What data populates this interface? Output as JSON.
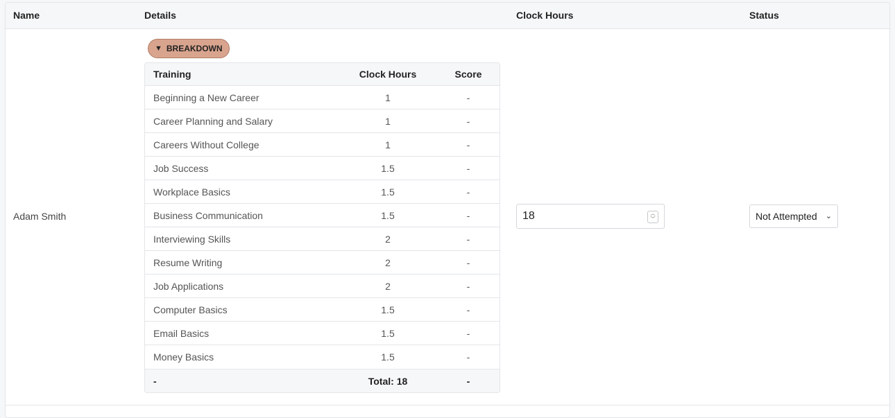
{
  "table": {
    "headers": {
      "name": "Name",
      "details": "Details",
      "clock_hours": "Clock Hours",
      "status": "Status"
    },
    "row": {
      "name": "Adam Smith",
      "breakdown_label": "BREAKDOWN",
      "breakdown_icon": "triangle-down-icon",
      "breakdown_color": "#d9a48e",
      "clock_hours_value": "18",
      "status_value": "Not Attempted"
    }
  },
  "breakdown": {
    "headers": {
      "training": "Training",
      "clock_hours": "Clock Hours",
      "score": "Score"
    },
    "rows": [
      {
        "training": "Beginning a New Career",
        "clock_hours": "1",
        "score": "-"
      },
      {
        "training": "Career Planning and Salary",
        "clock_hours": "1",
        "score": "-"
      },
      {
        "training": "Careers Without College",
        "clock_hours": "1",
        "score": "-"
      },
      {
        "training": "Job Success",
        "clock_hours": "1.5",
        "score": "-"
      },
      {
        "training": "Workplace Basics",
        "clock_hours": "1.5",
        "score": "-"
      },
      {
        "training": "Business Communication",
        "clock_hours": "1.5",
        "score": "-"
      },
      {
        "training": "Interviewing Skills",
        "clock_hours": "2",
        "score": "-"
      },
      {
        "training": "Resume Writing",
        "clock_hours": "2",
        "score": "-"
      },
      {
        "training": "Job Applications",
        "clock_hours": "2",
        "score": "-"
      },
      {
        "training": "Computer Basics",
        "clock_hours": "1.5",
        "score": "-"
      },
      {
        "training": "Email Basics",
        "clock_hours": "1.5",
        "score": "-"
      },
      {
        "training": "Money Basics",
        "clock_hours": "1.5",
        "score": "-"
      }
    ],
    "footer": {
      "training": "-",
      "clock_hours": "Total: 18",
      "score": "-"
    }
  }
}
